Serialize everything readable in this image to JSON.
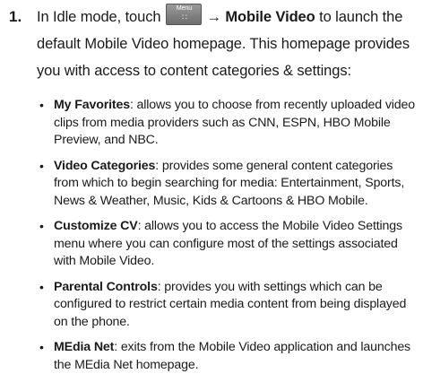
{
  "step": {
    "number": "1.",
    "text_before_key": "In Idle mode, touch",
    "menu_key_label": "Menu",
    "menu_key_grid": "∷",
    "arrow": "→",
    "target": "Mobile Video",
    "text_after": "to launch the default Mobile Video homepage. This homepage provides you with access to content categories & settings:"
  },
  "bullets": [
    {
      "term": "My Favorites",
      "desc": ": allows you to choose from recently uploaded video clips from media providers such as CNN, ESPN, HBO Mobile Preview, and NBC."
    },
    {
      "term": "Video Categories",
      "desc": ": provides some general content categories from which to begin searching for media: Entertainment, Sports, News & Weather, Music, Kids & Cartoons & HBO Mobile."
    },
    {
      "term": "Customize CV",
      "desc": ": allows you to access the Mobile Video Settings menu where you can configure most of the settings associated with Mobile Video."
    },
    {
      "term": "Parental Controls",
      "desc": ": provides you with settings which can be configured to restrict certain media content from being displayed on the phone."
    },
    {
      "term": "MEdia Net",
      "desc": ": exits from the Mobile Video application and launches the MEdia Net homepage."
    }
  ]
}
